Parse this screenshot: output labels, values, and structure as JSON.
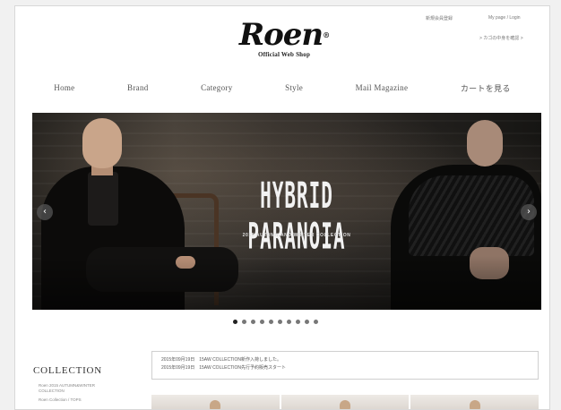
{
  "header": {
    "logo_text": "Roen",
    "logo_subtitle": "Official Web Shop",
    "util_links": [
      "新規会員登録",
      "My page / Login",
      "> カゴの中身を確認 >"
    ]
  },
  "nav": [
    "Home",
    "Brand",
    "Category",
    "Style",
    "Mail Magazine",
    "カートを見る"
  ],
  "hero": {
    "title": "HYBRID PARANOIA",
    "subtitle": "2015 AUTUMN AND WINTER COLLECTION",
    "prev_icon": "chevron-left-icon",
    "next_icon": "chevron-right-icon"
  },
  "slider": {
    "dot_count": 10,
    "active_index": 0
  },
  "sidebar": {
    "collection_title": "COLLECTION",
    "links": [
      "Roen 2015 AUTUMN&WINTER",
      "COLLECTION",
      "Roen Collection / TOPS"
    ]
  },
  "news": [
    "2015年09月19日　15AW COLLECTION新作入荷しました。",
    "2015年09月19日　15AW COLLECTION先行予約販売スタート"
  ]
}
